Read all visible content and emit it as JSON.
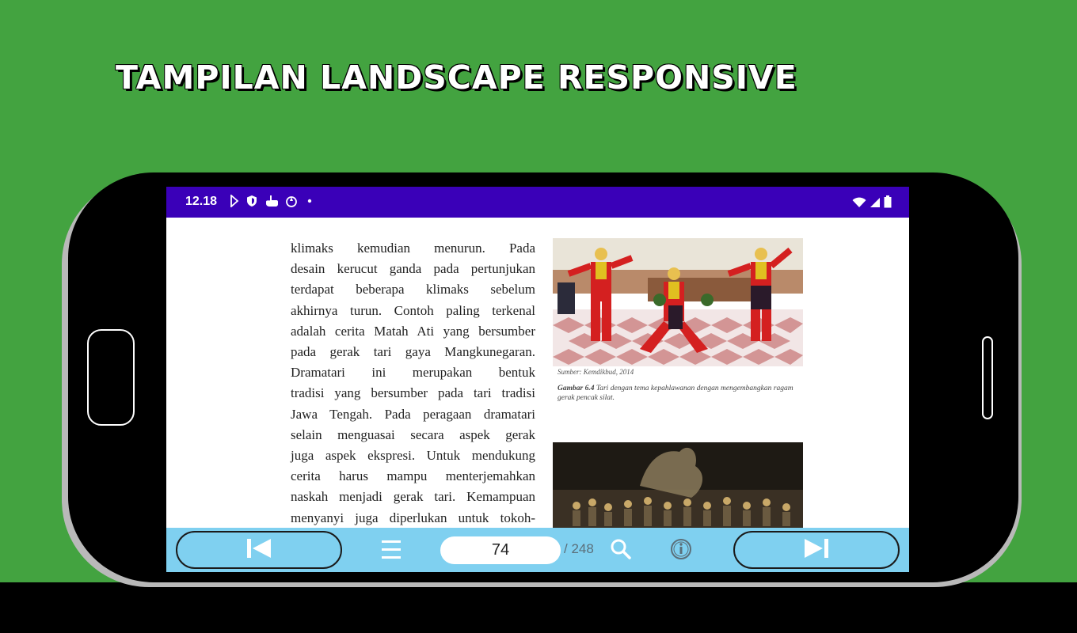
{
  "headline": "TAMPILAN LANDSCAPE RESPONSIVE",
  "status_bar": {
    "time": "12.18",
    "icons": [
      "play-store-notification-icon",
      "shield-icon",
      "hand-pointer-icon",
      "app-notification-icon",
      "dot-icon"
    ],
    "right_icons": [
      "wifi-icon",
      "cell-signal-icon",
      "battery-icon"
    ]
  },
  "reader": {
    "body_lines": [
      "klimaks kemudian menurun. Pada",
      "desain kerucut ganda pada pertunjukan",
      "terdapat beberapa klimaks sebelum",
      "akhirnya turun. Contoh paling terkenal",
      "adalah cerita Matah Ati yang bersumber",
      "pada gerak tari gaya Mangkunegaran.",
      "Dramatari ini merupakan bentuk",
      "tradisi yang bersumber pada tari tradisi",
      "Jawa Tengah. Pada peragaan dramatari",
      "selain menguasai secara aspek gerak",
      "juga aspek ekspresi. Untuk mendukung",
      "cerita harus mampu menterjemahkan",
      "naskah menjadi gerak tari. Kemampuan",
      "menyanyi juga diperlukan untuk tokoh-"
    ],
    "figure_source": "Sumber: Kemdikbud, 2014",
    "figure_caption_label": "Gambar 6.4",
    "figure_caption_text": "Tari dengan tema kepahlawanan dengan mengembangkan ragam gerak pencak silat."
  },
  "toolbar": {
    "page_value": "74",
    "page_total": "/ 248",
    "colors": {
      "bar": "#7fd0f0",
      "status_bar": "#3a00b8"
    }
  }
}
